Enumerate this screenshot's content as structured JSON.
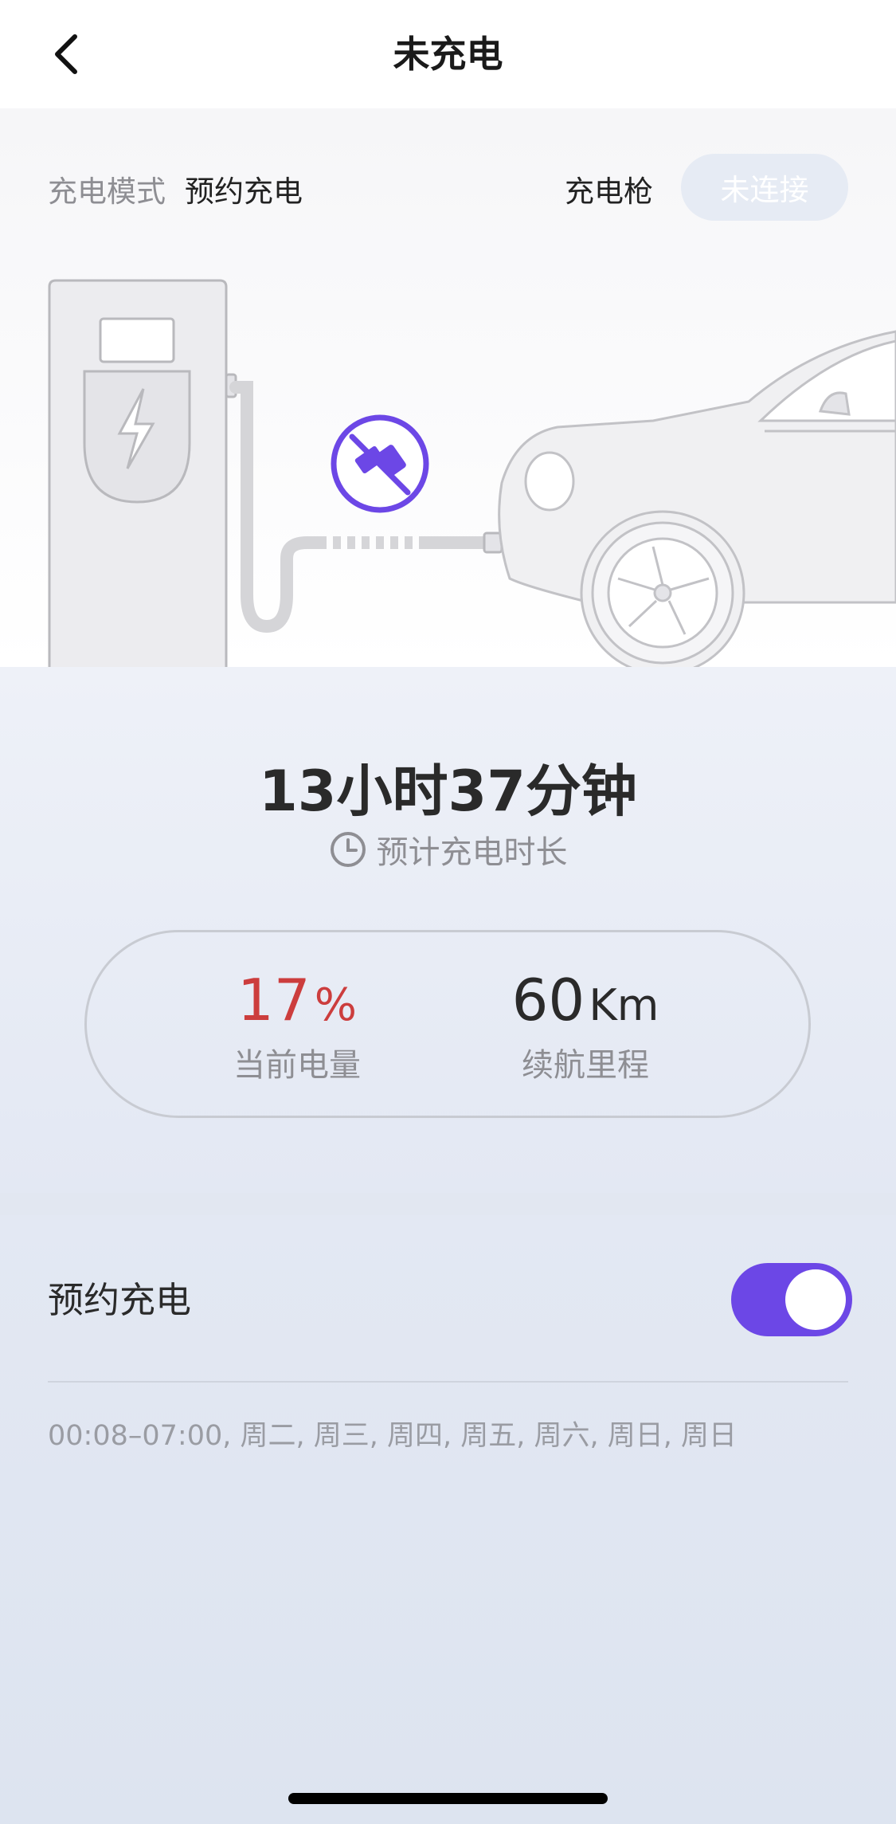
{
  "header": {
    "title": "未充电",
    "back_icon": "chevron-left-icon"
  },
  "hero": {
    "mode_label": "充电模式",
    "mode_value": "预约充电",
    "gun_label": "充电枪",
    "gun_status": "未连接",
    "unplugged_icon": "plug-disconnected-icon"
  },
  "summary": {
    "duration": "13小时37分钟",
    "estimate_label": "预计充电时长",
    "battery_value": "17",
    "battery_unit": "%",
    "battery_label": "当前电量",
    "range_value": "60",
    "range_unit": "Km",
    "range_label": "续航里程"
  },
  "schedule": {
    "label": "预约充电",
    "enabled": true,
    "days_text": "00:08–07:00, 周二, 周三, 周四, 周五, 周六, 周日, 周日"
  },
  "colors": {
    "accent": "#6c47e6",
    "battery": "#cc3d3d"
  }
}
